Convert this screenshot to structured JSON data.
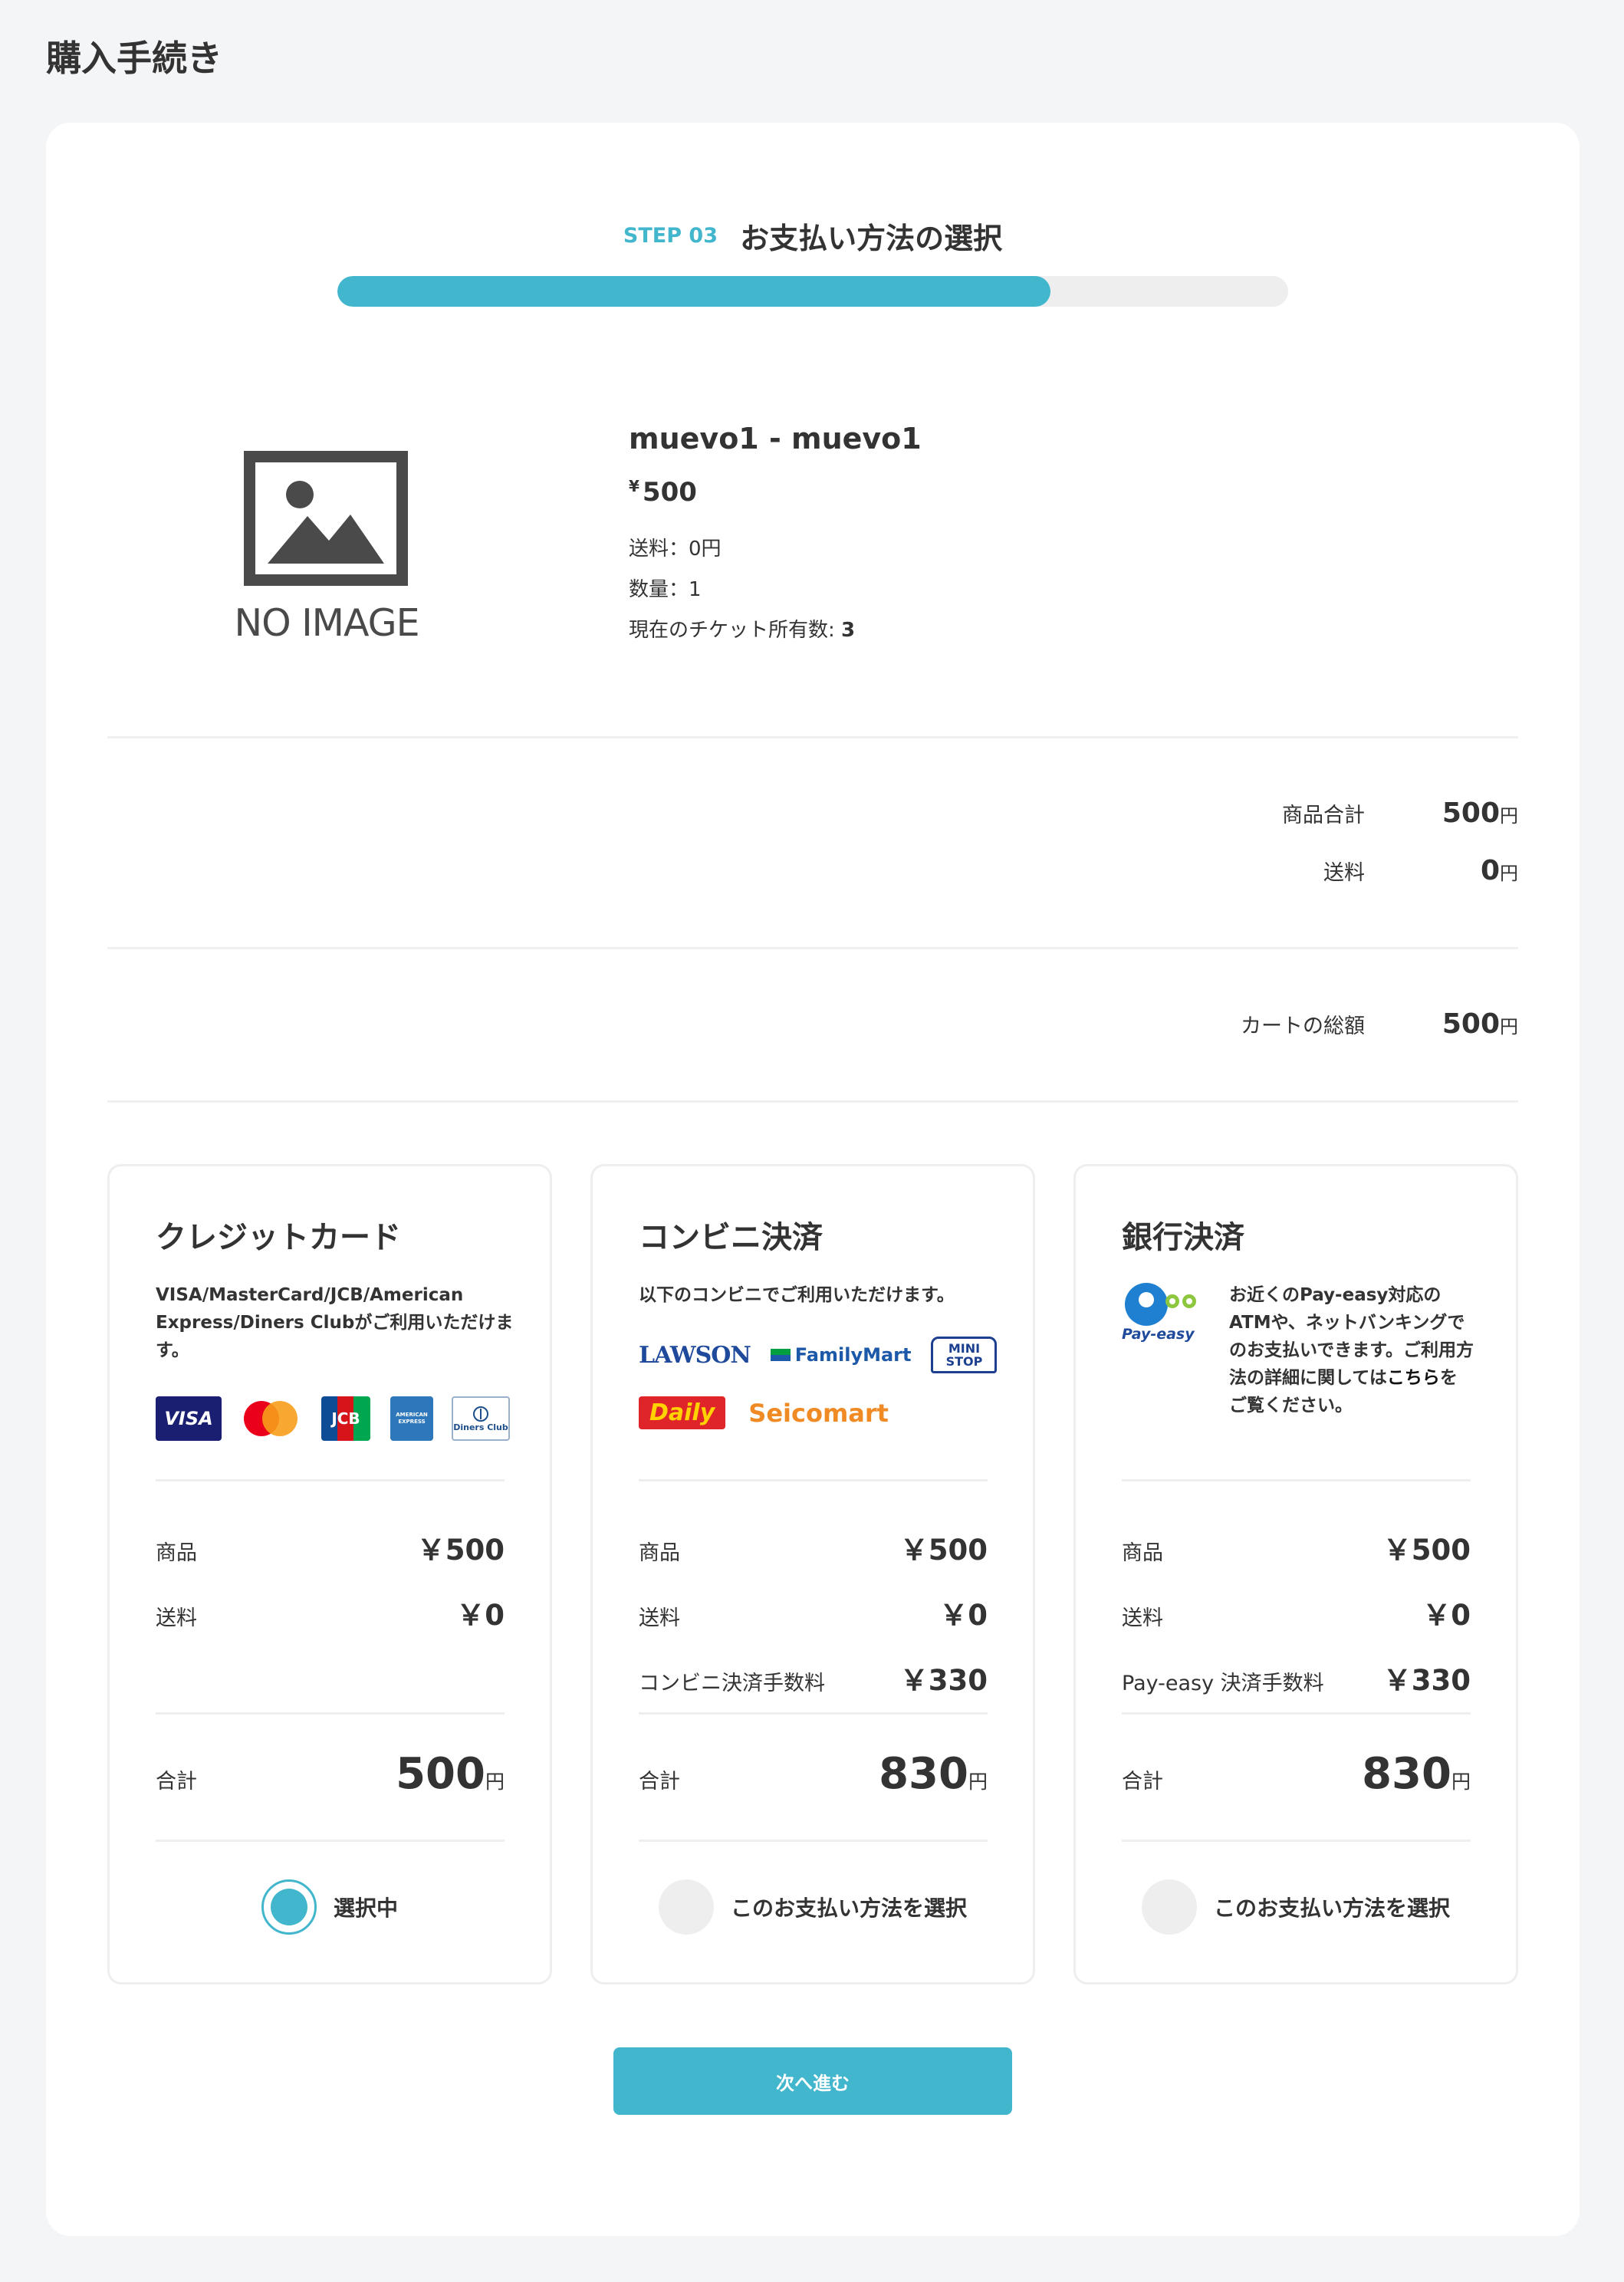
{
  "page_title": "購入手続き",
  "step": {
    "label": "STEP 03",
    "title": "お支払い方法の選択",
    "progress_percent": 75
  },
  "product": {
    "image_placeholder": "NO IMAGE",
    "name": "muevo1 - muevo1",
    "price_symbol": "¥",
    "price": "500",
    "shipping": "送料：0円",
    "quantity": "数量：1",
    "tickets_label": "現在のチケット所有数: ",
    "tickets_value": "3"
  },
  "summary": {
    "subtotal_label": "商品合計",
    "subtotal_value": "500",
    "shipping_label": "送料",
    "shipping_value": "0",
    "total_label": "カートの総額",
    "total_value": "500",
    "unit": "円"
  },
  "payment_methods": [
    {
      "title": "クレジットカード",
      "description": "VISA/MasterCard/JCB/American Express/Diners Clubがご利用いただけます。",
      "logos": [
        "VISA",
        "mastercard-icon",
        "JCB",
        "AMERICAN EXPRESS",
        "Diners Club"
      ],
      "item_label": "商品",
      "item_value": "￥500",
      "shipping_label": "送料",
      "shipping_value": "￥0",
      "total_label": "合計",
      "total_value": "500",
      "unit": "円",
      "select_label": "選択中",
      "selected": true
    },
    {
      "title": "コンビニ決済",
      "description": "以下のコンビニでご利用いただけます。",
      "logos": [
        "LAWSON",
        "FamilyMart",
        "MINI STOP",
        "Daily",
        "Seicomart"
      ],
      "item_label": "商品",
      "item_value": "￥500",
      "shipping_label": "送料",
      "shipping_value": "￥0",
      "fee_label": "コンビニ決済手数料",
      "fee_value": "￥330",
      "total_label": "合計",
      "total_value": "830",
      "unit": "円",
      "select_label": "このお支払い方法を選択",
      "selected": false
    },
    {
      "title": "銀行決済",
      "description_pre": "お近くのPay-easy対応のATMや、ネットバンキングでのお支払いできます。ご利用方法の詳細に関しては",
      "description_link": "こちら",
      "description_post": "をご覧ください。",
      "logo": "Pay-easy",
      "item_label": "商品",
      "item_value": "￥500",
      "shipping_label": "送料",
      "shipping_value": "￥0",
      "fee_label": "Pay-easy 決済手数料",
      "fee_value": "￥330",
      "total_label": "合計",
      "total_value": "830",
      "unit": "円",
      "select_label": "このお支払い方法を選択",
      "selected": false
    }
  ],
  "next_button": "次へ進む",
  "colors": {
    "accent": "#42b6cc",
    "background": "#f4f5f7",
    "text": "#333333"
  }
}
